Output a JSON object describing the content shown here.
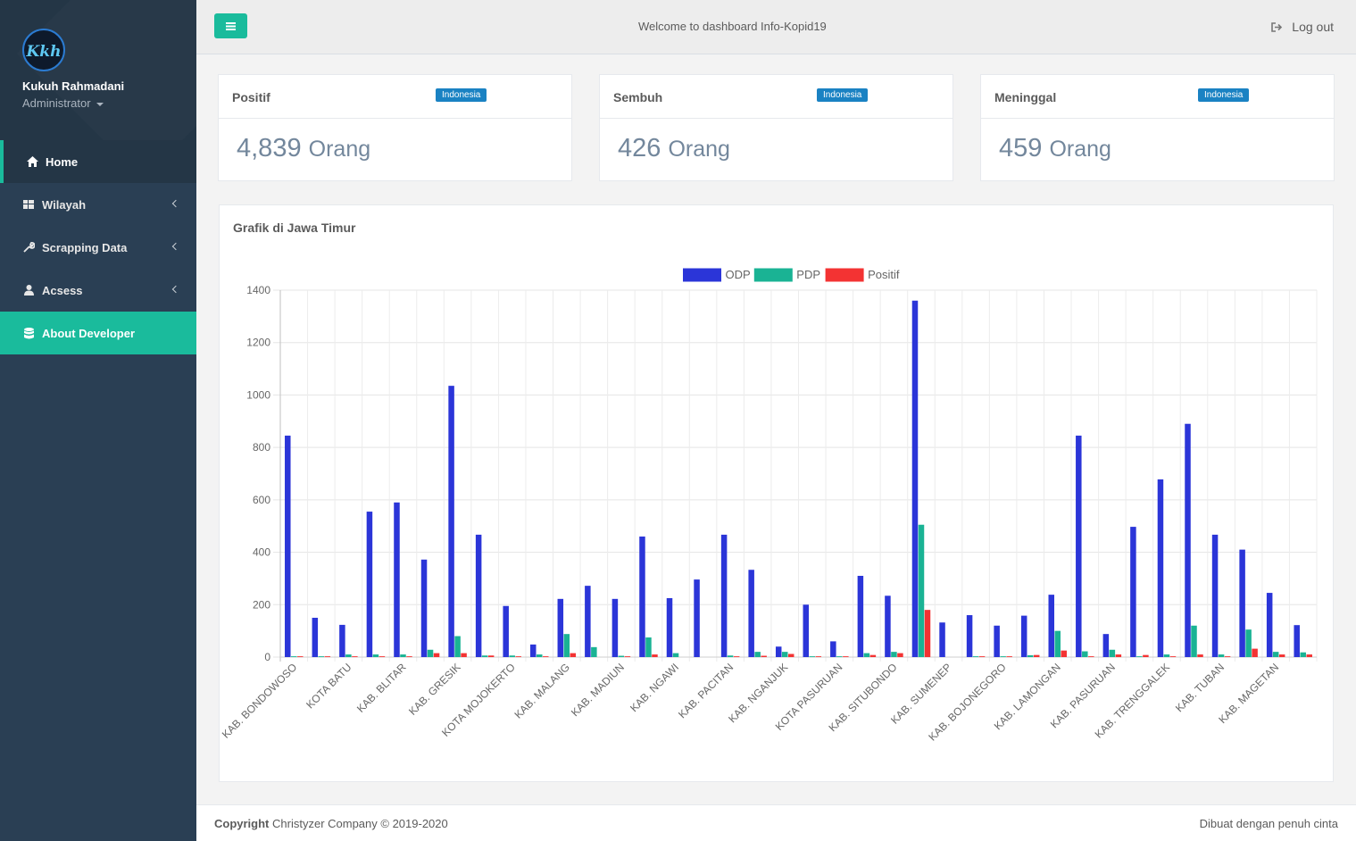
{
  "profile": {
    "logo_text": "Kkh",
    "name": "Kukuh Rahmadani",
    "role": "Administrator"
  },
  "nav": {
    "items": [
      {
        "label": "Home",
        "icon": "home-icon"
      },
      {
        "label": "Wilayah",
        "icon": "grid-icon"
      },
      {
        "label": "Scrapping Data",
        "icon": "wrench-icon"
      },
      {
        "label": "Acsess",
        "icon": "user-icon"
      },
      {
        "label": "About Developer",
        "icon": "database-icon"
      }
    ]
  },
  "topbar": {
    "welcome": "Welcome to dashboard Info-Kopid19",
    "logout_label": "Log out"
  },
  "stats": [
    {
      "title": "Positif",
      "badge": "Indonesia",
      "value": "4,839",
      "unit": "Orang"
    },
    {
      "title": "Sembuh",
      "badge": "Indonesia",
      "value": "426",
      "unit": "Orang"
    },
    {
      "title": "Meninggal",
      "badge": "Indonesia",
      "value": "459",
      "unit": "Orang"
    }
  ],
  "panel": {
    "title": "Grafik di Jawa Timur"
  },
  "chart_data": {
    "type": "bar",
    "categories": [
      "KAB. BONDOWOSO",
      "KOTA BATU",
      "KAB. BLITAR",
      "KAB. GRESIK",
      "KOTA MOJOKERTO",
      "KAB. MALANG",
      "KAB. MADIUN",
      "KAB. NGAWI",
      "KAB. PACITAN",
      "KAB. NGANJUK",
      "KOTA PASURUAN",
      "KAB. SITUBONDO",
      "KAB. SUMENEP",
      "KAB. BOJONEGORO",
      "KAB. LAMONGAN",
      "KAB. PASURUAN",
      "KAB. TRENGGALEK",
      "KAB. TUBAN",
      "KAB. MAGETAN"
    ],
    "series": [
      {
        "name": "ODP",
        "color": "#2b35d8",
        "values": [
          845,
          150,
          123,
          555,
          590,
          372,
          1035,
          467,
          195,
          48,
          222,
          272,
          222,
          460,
          225,
          296,
          467,
          333,
          40,
          200,
          60,
          310,
          234,
          1360,
          132,
          160,
          120,
          158,
          238,
          845,
          88,
          497,
          678,
          890,
          467,
          410,
          245,
          122
        ]
      },
      {
        "name": "PDP",
        "color": "#1ab394",
        "values": [
          3,
          3,
          10,
          10,
          10,
          28,
          80,
          6,
          6,
          10,
          88,
          38,
          5,
          75,
          15,
          0,
          6,
          20,
          20,
          3,
          3,
          15,
          20,
          505,
          0,
          3,
          3,
          7,
          100,
          22,
          28,
          3,
          10,
          120,
          10,
          105,
          20,
          18
        ]
      },
      {
        "name": "Positif",
        "color": "#f33333",
        "values": [
          3,
          3,
          3,
          3,
          3,
          15,
          15,
          6,
          3,
          3,
          15,
          0,
          3,
          10,
          0,
          0,
          3,
          5,
          12,
          3,
          3,
          8,
          15,
          180,
          0,
          3,
          3,
          8,
          25,
          3,
          10,
          8,
          3,
          10,
          3,
          32,
          10,
          10
        ]
      }
    ],
    "ylim": [
      0,
      1400
    ],
    "yticks": [
      0,
      200,
      400,
      600,
      800,
      1000,
      1200,
      1400
    ],
    "grid": true,
    "legend": "top-center",
    "note_categories_count": 38
  },
  "footer": {
    "copyright_label": "Copyright",
    "copyright_text": "Christyzer Company © 2019-2020",
    "right_text": "Dibuat dengan penuh cinta"
  }
}
